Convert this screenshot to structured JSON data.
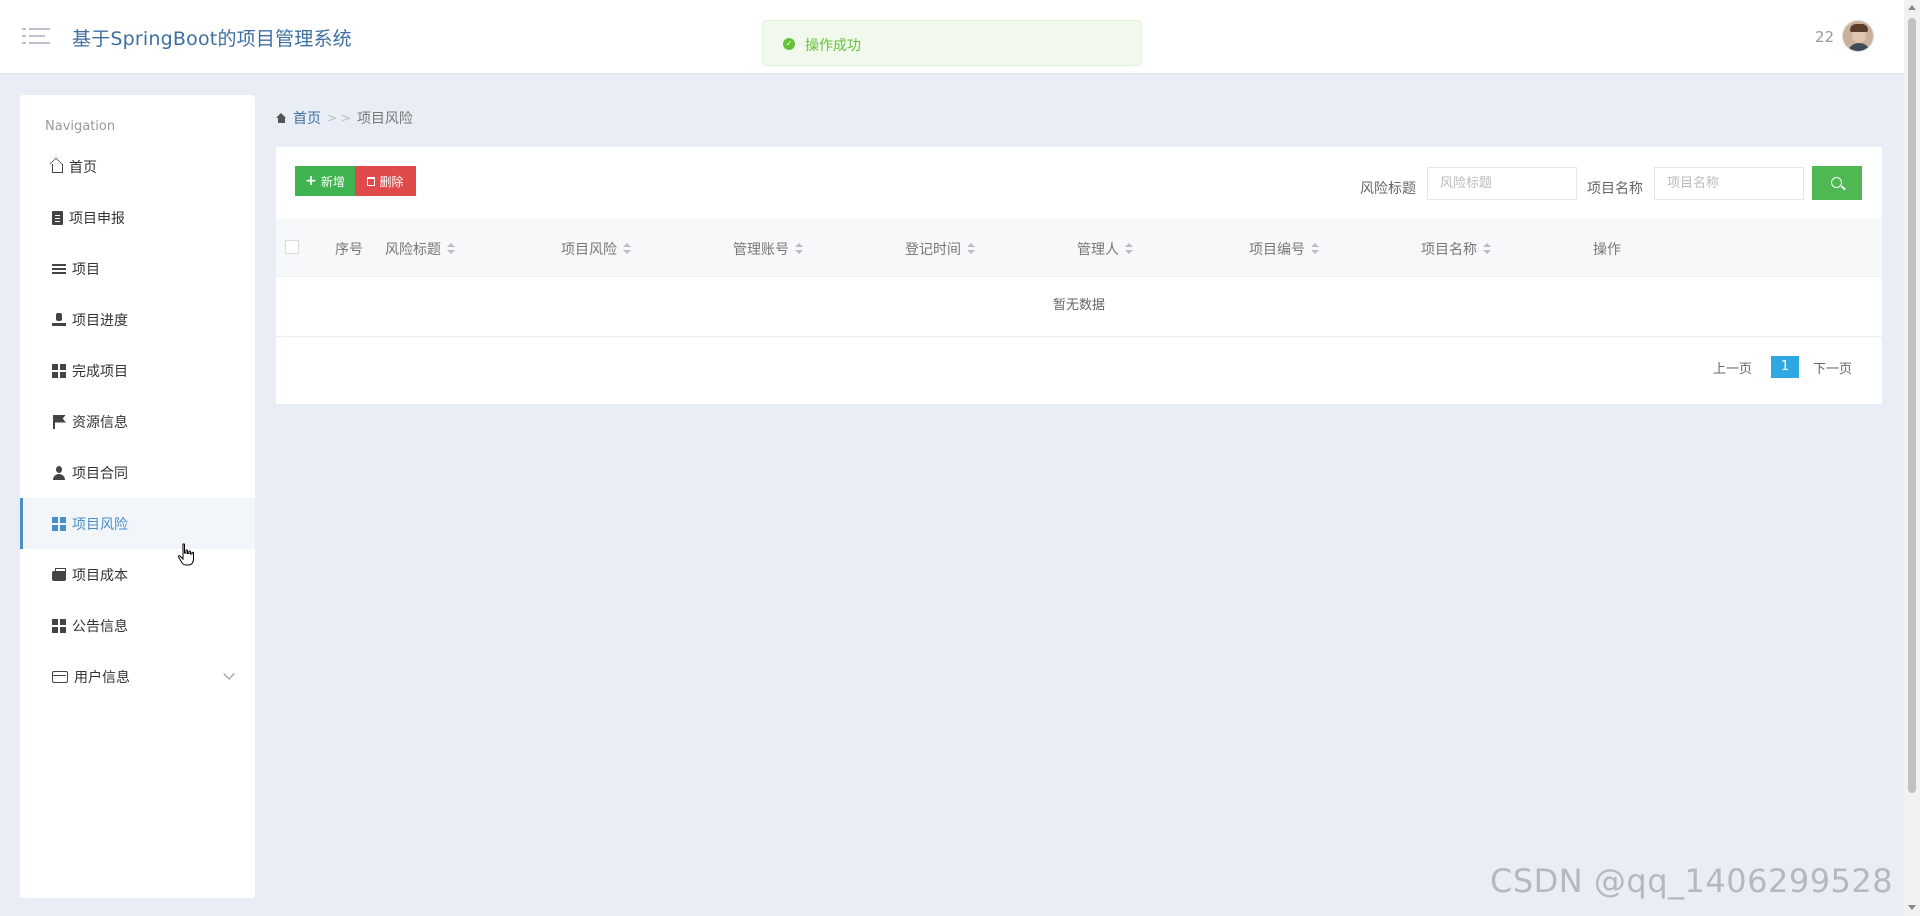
{
  "header": {
    "title": "基于SpringBoot的项目管理系统",
    "user_id": "22"
  },
  "toast": {
    "message": "操作成功",
    "color": "#67c23a"
  },
  "sidebar": {
    "caption": "Navigation",
    "items": [
      {
        "label": "首页",
        "icon": "home-icon"
      },
      {
        "label": "项目申报",
        "icon": "clipboard-icon"
      },
      {
        "label": "项目",
        "icon": "list-icon"
      },
      {
        "label": "项目进度",
        "icon": "stamp-icon"
      },
      {
        "label": "完成项目",
        "icon": "grid-icon"
      },
      {
        "label": "资源信息",
        "icon": "flag-icon"
      },
      {
        "label": "项目合同",
        "icon": "user-icon"
      },
      {
        "label": "项目风险",
        "icon": "grid-icon",
        "active": true
      },
      {
        "label": "项目成本",
        "icon": "wallet-icon"
      },
      {
        "label": "公告信息",
        "icon": "grid-icon"
      },
      {
        "label": "用户信息",
        "icon": "card-icon",
        "expandable": true
      }
    ],
    "active_color": "#4a8ec9"
  },
  "breadcrumb": {
    "home": "首页",
    "separator": "> >",
    "current": "项目风险"
  },
  "toolbar": {
    "add_label": "新增",
    "delete_label": "删除",
    "filters": [
      {
        "label": "风险标题",
        "placeholder": "风险标题"
      },
      {
        "label": "项目名称",
        "placeholder": "项目名称"
      }
    ]
  },
  "table": {
    "columns": [
      "序号",
      "风险标题",
      "项目风险",
      "管理账号",
      "登记时间",
      "管理人",
      "项目编号",
      "项目名称",
      "操作"
    ],
    "empty_text": "暂无数据"
  },
  "pagination": {
    "prev": "上一页",
    "current": "1",
    "next": "下一页"
  },
  "watermark": "CSDN @qq_1406299528"
}
